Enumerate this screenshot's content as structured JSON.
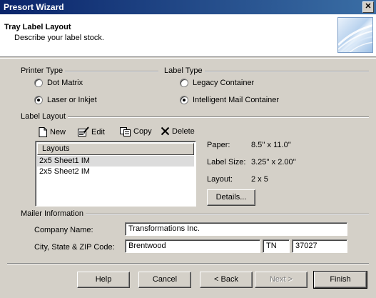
{
  "window": {
    "title": "Presort Wizard",
    "close_glyph": "✕"
  },
  "header": {
    "title": "Tray Label Layout",
    "subtitle": "Describe your label stock."
  },
  "printer_type": {
    "label": "Printer Type",
    "options": [
      {
        "label": "Dot Matrix",
        "selected": false
      },
      {
        "label": "Laser or Inkjet",
        "selected": true
      }
    ]
  },
  "label_type": {
    "label": "Label Type",
    "options": [
      {
        "label": "Legacy Container",
        "selected": false
      },
      {
        "label": "Intelligent Mail Container",
        "selected": true
      }
    ]
  },
  "label_layout": {
    "label": "Label Layout",
    "toolbar": {
      "new": "New",
      "edit": "Edit",
      "copy": "Copy",
      "delete": "Delete"
    },
    "list": {
      "header": "Layouts",
      "items": [
        "2x5 Sheet1 IM",
        "2x5 Sheet2 IM"
      ],
      "selected_index": 0
    },
    "details": {
      "paper_label": "Paper:",
      "paper_value": "8.5'' x 11.0''",
      "size_label": "Label Size:",
      "size_value": "3.25'' x 2.00''",
      "layout_label": "Layout:",
      "layout_value": "2 x 5",
      "details_button": "Details..."
    }
  },
  "mailer": {
    "label": "Mailer Information",
    "company_label": "Company Name:",
    "company_value": "Transformations Inc.",
    "city_label": "City, State & ZIP Code:",
    "city_value": "Brentwood",
    "state_value": "TN",
    "zip_value": "37027"
  },
  "buttons": {
    "help": "Help",
    "cancel": "Cancel",
    "back": "< Back",
    "next": "Next >",
    "finish": "Finish"
  }
}
